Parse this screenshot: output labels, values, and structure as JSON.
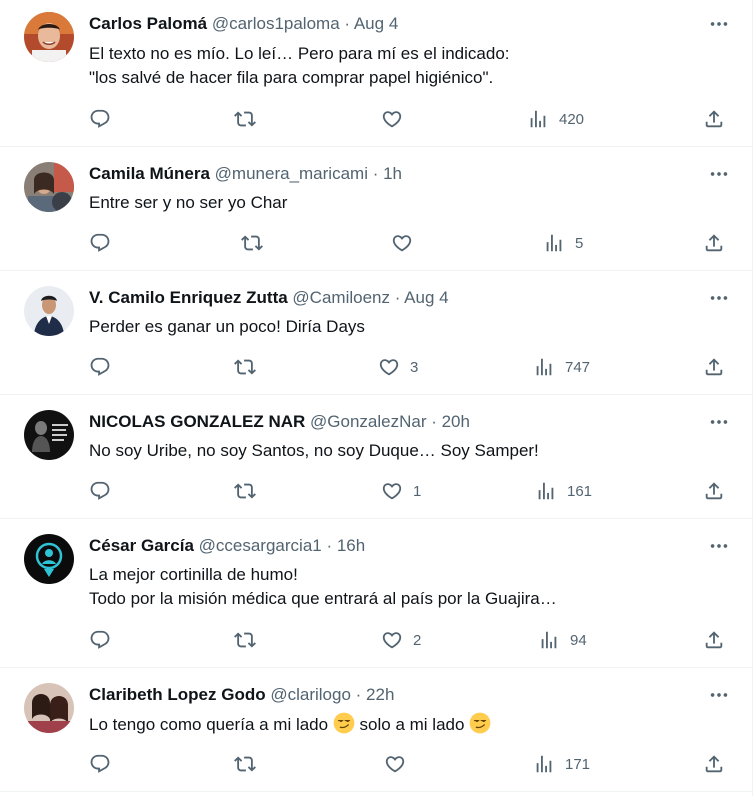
{
  "tweets": [
    {
      "name": "Carlos Palomá",
      "handle": "@carlos1paloma",
      "time": "Aug 4",
      "text": "El texto no es mío. Lo leí… Pero para mí es el indicado:\n\"los salvé de hacer fila para comprar papel higiénico\".",
      "replies": "",
      "retweets": "",
      "likes": "",
      "views": "420"
    },
    {
      "name": "Camila Múnera",
      "handle": "@munera_maricami",
      "time": "1h",
      "text": "Entre ser y no ser yo Char",
      "replies": "",
      "retweets": "",
      "likes": "",
      "views": "5"
    },
    {
      "name": "V. Camilo Enriquez Zutta",
      "handle": "@Camiloenz",
      "time": "Aug 4",
      "text": "Perder es ganar un poco! Diría Days",
      "replies": "",
      "retweets": "",
      "likes": "3",
      "views": "747"
    },
    {
      "name": "NICOLAS GONZALEZ NAR",
      "handle": "@GonzalezNar",
      "time": "20h",
      "text": "No soy Uribe, no soy Santos, no soy Duque…  Soy Samper!",
      "replies": "",
      "retweets": "",
      "likes": "1",
      "views": "161"
    },
    {
      "name": "César García",
      "handle": "@ccesargarcia1",
      "time": "16h",
      "text": "La mejor cortinilla de humo!\nTodo por la misión médica que entrará al país por la Guajira…",
      "replies": "",
      "retweets": "",
      "likes": "2",
      "views": "94"
    },
    {
      "name": "Claribeth Lopez Godo",
      "handle": "@clarilogo",
      "time": "22h",
      "text_parts": [
        "Lo tengo como quería a mi lado ",
        " solo a mi lado "
      ],
      "emoji": "smirking-face",
      "replies": "",
      "retweets": "",
      "likes": "",
      "views": "171"
    }
  ],
  "separator": " · ",
  "colors": {
    "text": "#0f1419",
    "secondary": "#536471",
    "border": "#eff3f4"
  }
}
